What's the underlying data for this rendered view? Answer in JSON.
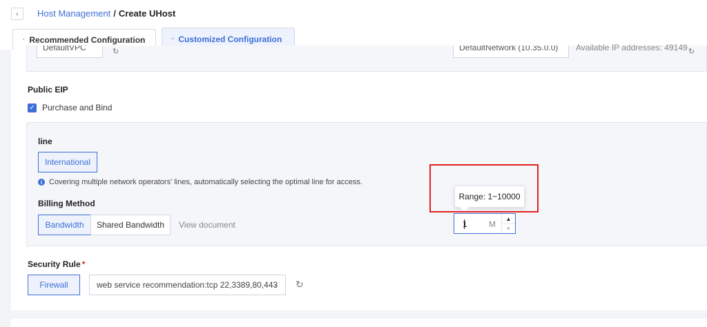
{
  "breadcrumb": {
    "back_icon": "chevron-left-icon",
    "parent": "Host Management",
    "separator": "/",
    "current": "Create UHost"
  },
  "tabs": [
    {
      "label": "Recommended Configuration",
      "active": false
    },
    {
      "label": "Customized Configuration",
      "active": true
    }
  ],
  "network": {
    "vpc_value": "DefaultVPC",
    "subnet_value": "DefaultNetwork (10.35.0.0)",
    "available_ips": "Available IP addresses: 49149"
  },
  "public_eip": {
    "title": "Public EIP",
    "purchase_label": "Purchase and Bind",
    "purchase_checked": true,
    "line_title": "line",
    "line_option": "International",
    "line_info": "Covering multiple network operators' lines, automatically selecting the optimal line for access.",
    "billing_title": "Billing Method",
    "billing_options": [
      "Bandwidth",
      "Shared Bandwidth"
    ],
    "billing_selected": "Bandwidth",
    "view_document": "View document",
    "bandwidth_value": "1",
    "bandwidth_unit": "M",
    "range_tooltip": "Range: 1~10000"
  },
  "security": {
    "title": "Security Rule",
    "required_mark": "*",
    "firewall_label": "Firewall",
    "rule_value": "web service recommendation:tcp 22,3389,80,443"
  },
  "colors": {
    "accent": "#3d6fd6",
    "highlight_box": "#e02020"
  }
}
